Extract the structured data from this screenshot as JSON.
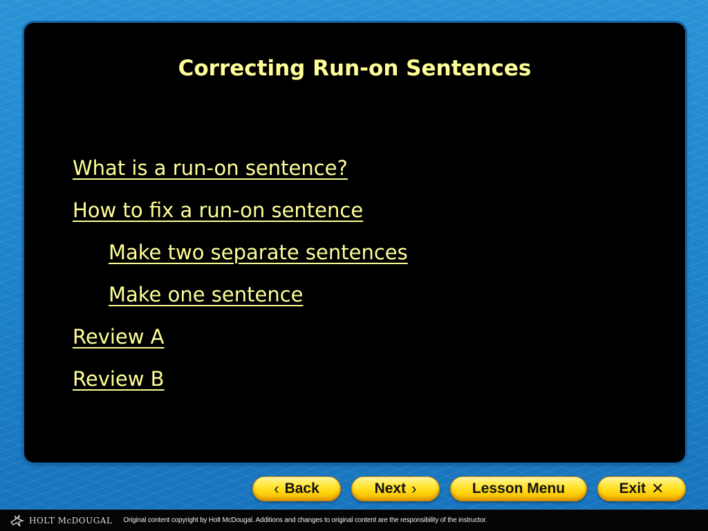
{
  "slide": {
    "title": "Correcting Run-on Sentences",
    "links": [
      {
        "label": "What is a run-on sentence?",
        "indent": false
      },
      {
        "label": "How to fix a run-on sentence",
        "indent": false
      },
      {
        "label": "Make two separate sentences",
        "indent": true
      },
      {
        "label": "Make one sentence",
        "indent": true
      },
      {
        "label": "Review A",
        "indent": false
      },
      {
        "label": "Review B",
        "indent": false
      }
    ]
  },
  "nav": {
    "back": {
      "label": "Back",
      "icon": "‹"
    },
    "next": {
      "label": "Next",
      "icon": "›"
    },
    "lesson_menu": {
      "label": "Lesson Menu"
    },
    "exit": {
      "label": "Exit",
      "icon": "✕"
    }
  },
  "footer": {
    "brand": "HOLT McDOUGAL",
    "copyright": "Original content copyright by Holt McDougal. Additions and changes to original content are the responsibility of the instructor."
  },
  "colors": {
    "link_text": "#ffff99",
    "panel": "#000000",
    "background": "#1f86cc",
    "button": "#ffd812"
  }
}
